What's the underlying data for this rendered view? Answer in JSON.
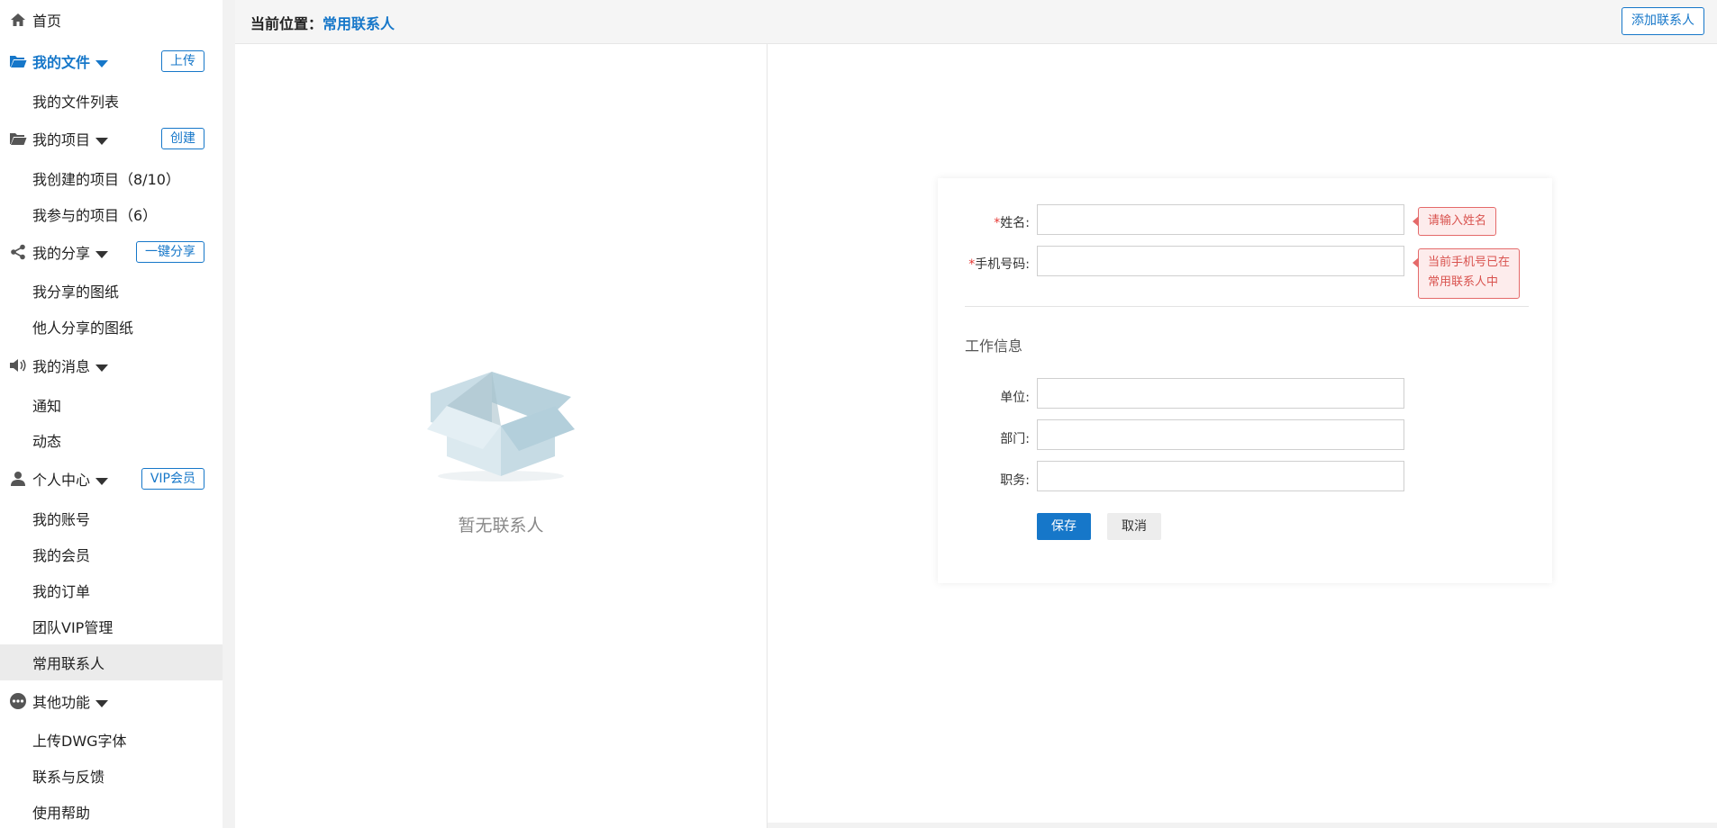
{
  "sidebar": {
    "home": "首页",
    "files": {
      "label": "我的文件",
      "button": "上传",
      "items": [
        "我的文件列表"
      ]
    },
    "projects": {
      "label": "我的项目",
      "button": "创建",
      "items": [
        "我创建的项目（8/10）",
        "我参与的项目（6）"
      ]
    },
    "share": {
      "label": "我的分享",
      "button": "一键分享",
      "items": [
        "我分享的图纸",
        "他人分享的图纸"
      ]
    },
    "messages": {
      "label": "我的消息",
      "items": [
        "通知",
        "动态"
      ]
    },
    "personal": {
      "label": "个人中心",
      "button": "VIP会员",
      "items": [
        "我的账号",
        "我的会员",
        "我的订单",
        "团队VIP管理",
        "常用联系人"
      ]
    },
    "other": {
      "label": "其他功能",
      "items": [
        "上传DWG字体",
        "联系与反馈",
        "使用帮助"
      ]
    }
  },
  "topbar": {
    "crumb_prefix": "当前位置：",
    "crumb_current": "常用联系人",
    "add_button": "添加联系人"
  },
  "list": {
    "empty_text": "暂无联系人"
  },
  "form": {
    "required_mark": "*",
    "name_label": "姓名:",
    "phone_label": "手机号码:",
    "name_tip": "请输入姓名",
    "phone_tip_line1": "当前手机号已在",
    "phone_tip_line2": "常用联系人中",
    "section_title": "工作信息",
    "company_label": "单位:",
    "department_label": "部门:",
    "position_label": "职务:",
    "save": "保存",
    "cancel": "取消"
  },
  "colors": {
    "accent": "#1677c9",
    "error": "#d9534f"
  }
}
